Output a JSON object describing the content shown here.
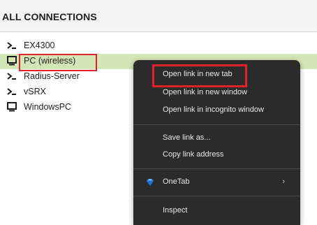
{
  "header": {
    "title": "ALL CONNECTIONS"
  },
  "connections": [
    {
      "label": "EX4300",
      "icon": "terminal-icon"
    },
    {
      "label": "PC (wireless)",
      "icon": "monitor-icon",
      "selected": true
    },
    {
      "label": "Radius-Server",
      "icon": "terminal-icon"
    },
    {
      "label": "vSRX",
      "icon": "terminal-icon"
    },
    {
      "label": "WindowsPC",
      "icon": "monitor-icon"
    }
  ],
  "context_menu": {
    "items": [
      {
        "label": "Open link in new tab"
      },
      {
        "label": "Open link in new window"
      },
      {
        "label": "Open link in incognito window"
      },
      {
        "label": "Save link as..."
      },
      {
        "label": "Copy link address"
      },
      {
        "label": "OneTab",
        "icon": "onetab-gem-icon",
        "submenu": true,
        "submenu_glyph": "›"
      },
      {
        "label": "Inspect"
      }
    ]
  },
  "colors": {
    "selected_row": "#d3e6b5",
    "highlight_box": "#e3212b",
    "menu_bg": "#2b2b2b",
    "header_bg": "#f3f3f3"
  }
}
